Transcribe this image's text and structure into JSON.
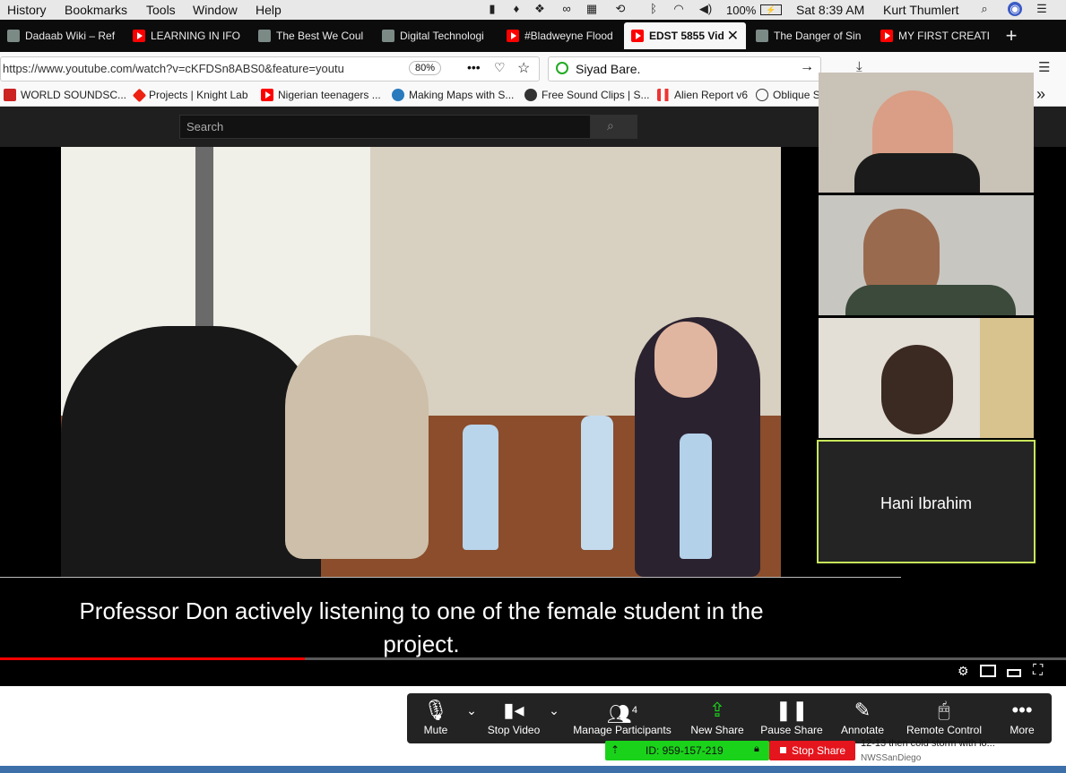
{
  "menubar": {
    "items": [
      "History",
      "Bookmarks",
      "Tools",
      "Window",
      "Help"
    ],
    "battery": "100%",
    "clock": "Sat 8:39 AM",
    "user": "Kurt Thumlert"
  },
  "tabs": [
    {
      "label": "Dadaab Wiki – Ref",
      "icon": "wiki-image-icon"
    },
    {
      "label": "LEARNING IN IFO",
      "icon": "youtube-icon"
    },
    {
      "label": "The Best We Coul",
      "icon": "image-icon"
    },
    {
      "label": "Digital Technologi",
      "icon": "image-icon"
    },
    {
      "label": "#Bladweyne Flood",
      "icon": "youtube-icon"
    },
    {
      "label": "EDST 5855 Vid",
      "icon": "youtube-icon",
      "active": true
    },
    {
      "label": "The Danger of Sin",
      "icon": "image-icon"
    },
    {
      "label": "MY FIRST CREATI",
      "icon": "youtube-icon"
    }
  ],
  "new_tab": "+",
  "url": "https://www.youtube.com/watch?v=cKFDSn8ABS0&feature=youtu",
  "zoom": "80%",
  "search_value": "Siyad Bare.",
  "bookmarks": [
    {
      "label": "WORLD SOUNDSC...",
      "icon": "sfu-icon"
    },
    {
      "label": "Projects | Knight Lab",
      "icon": "knightlab-icon"
    },
    {
      "label": "Nigerian teenagers ...",
      "icon": "youtube-icon"
    },
    {
      "label": "Making Maps with S...",
      "icon": "wordpress-icon"
    },
    {
      "label": "Free Sound Clips | S...",
      "icon": "soundbible-icon"
    },
    {
      "label": "Alien Report v6",
      "icon": "bars-icon"
    },
    {
      "label": "Oblique S",
      "icon": "globe-icon"
    }
  ],
  "youtube": {
    "search_placeholder": "Search",
    "caption_line1": "Professor Don actively listening to one of the female student in the",
    "caption_line2": "project.",
    "progress": 0.286
  },
  "zoom_app": {
    "participant_name": "Hani Ibrahim",
    "participants_count": "4",
    "meeting_id": "ID: 959-157-219",
    "stop_share": "Stop Share",
    "buttons": {
      "mute": "Mute",
      "stop_video": "Stop Video",
      "manage": "Manage Participants",
      "new_share": "New Share",
      "pause": "Pause Share",
      "annotate": "Annotate",
      "remote": "Remote Control",
      "more": "More"
    }
  },
  "notification": {
    "text": "12-13 then cold storm with lo...",
    "source": "NWSSanDiego"
  },
  "colors": {
    "youtube_red": "#ff0000",
    "zoom_green": "#1bd21b",
    "zoom_stop_red": "#e5151d",
    "active_tile_border": "#c8e65a"
  }
}
